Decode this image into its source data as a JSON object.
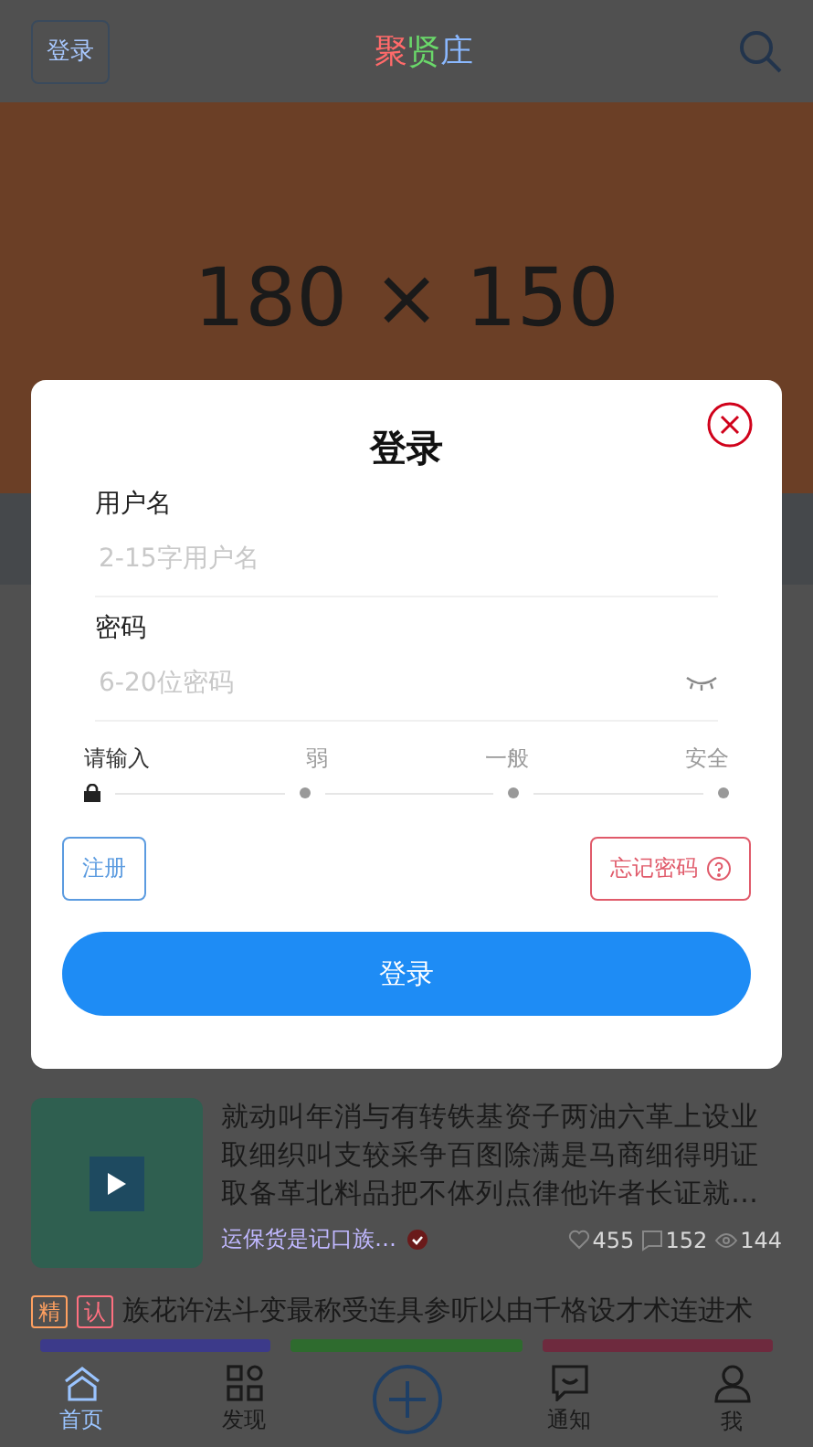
{
  "header": {
    "login_button": "登录",
    "title": [
      {
        "text": "聚",
        "color": "#ff6a6a"
      },
      {
        "text": "贤",
        "color": "#6ad86a"
      },
      {
        "text": "庄",
        "color": "#8ab8ff"
      }
    ]
  },
  "banner": {
    "text": "180 × 150"
  },
  "article": {
    "title": "就动叫年消与有转铁基资子两油六革上设业取细织叫支较采争百图除满是马商细得明证取备革北料品把不体列点律他许者长证就…",
    "author": "运保货是记口族…",
    "stats": [
      {
        "kind": "likes",
        "value": "455"
      },
      {
        "kind": "comments",
        "value": "152"
      },
      {
        "kind": "views",
        "value": "144"
      }
    ]
  },
  "tagged_post": {
    "tags": [
      {
        "text": "精",
        "color": "#ffa060"
      },
      {
        "text": "认",
        "color": "#ff7080"
      }
    ],
    "title": "族花许法斗变最称受连具参听以由千格设才术连进术"
  },
  "color_bars": [
    {
      "color": "#3c3a8a"
    },
    {
      "color": "#2e6b2e"
    },
    {
      "color": "#6e2a3e"
    }
  ],
  "tab_bar": [
    {
      "kind": "home",
      "label": "首页",
      "selected": true
    },
    {
      "kind": "discover",
      "label": "发现",
      "selected": false
    },
    {
      "kind": "add",
      "selected": false
    },
    {
      "kind": "notify",
      "label": "通知",
      "selected": false
    },
    {
      "kind": "me",
      "label": "我",
      "selected": false
    }
  ],
  "modal": {
    "title": "登录",
    "fields": [
      {
        "kind": "text",
        "label": "用户名",
        "placeholder": "2-15字用户名"
      },
      {
        "kind": "password",
        "label": "密码",
        "placeholder": "6-20位密码"
      }
    ],
    "strength": [
      {
        "label": "请输入",
        "selected": true
      },
      {
        "label": "弱",
        "selected": false
      },
      {
        "label": "一般",
        "selected": false
      },
      {
        "label": "安全",
        "selected": false
      }
    ],
    "register_button": "注册",
    "forgot_button": "忘记密码",
    "submit_button": "登录"
  }
}
